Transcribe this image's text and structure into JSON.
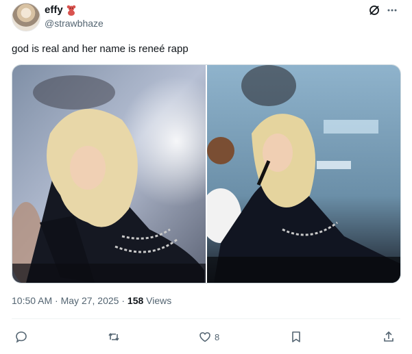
{
  "author": {
    "display_name": "effy",
    "handle": "@strawbhaze",
    "badge_icon": "teddy-bear-icon"
  },
  "tweet": {
    "text": "god is real and her name is reneé rapp"
  },
  "media": {
    "photo_count": 2
  },
  "meta": {
    "time": "10:50 AM",
    "separator": "·",
    "date": "May 27, 2025",
    "separator2": "·",
    "views_count": "158",
    "views_label": "Views"
  },
  "actions": {
    "reply_count": "",
    "repost_count": "",
    "like_count": "8",
    "bookmark_count": ""
  },
  "colors": {
    "text_primary": "#0f1419",
    "text_secondary": "#536471",
    "border": "#cfd9de"
  }
}
